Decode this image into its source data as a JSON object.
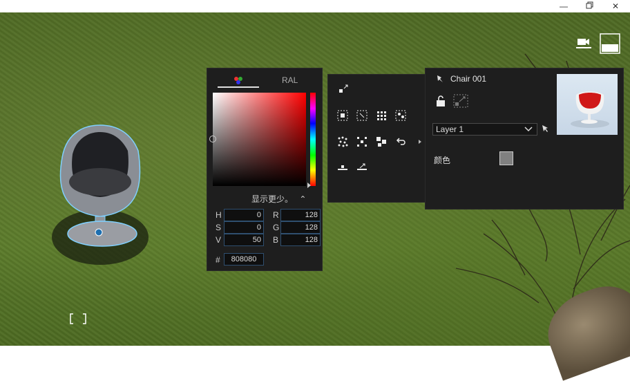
{
  "window": {
    "min_icon": "minimize-icon",
    "restore_icon": "restore-icon",
    "close_icon": "close-icon"
  },
  "viewport": {
    "camera_icon": "camera-icon",
    "layout_icon": "layout-toggle-icon",
    "frame_icon": "frame-selection-icon"
  },
  "color_picker": {
    "tabs": {
      "wheel_icon": "color-wheel-icon",
      "ral_label": "RAL"
    },
    "show_less_label": "显示更少。",
    "show_less_icon": "chevron-up-icon",
    "hsv": {
      "h_label": "H",
      "h_value": "0",
      "s_label": "S",
      "s_value": "0",
      "v_label": "V",
      "v_value": "50"
    },
    "rgb": {
      "r_label": "R",
      "r_value": "128",
      "g_label": "G",
      "g_value": "128",
      "b_label": "B",
      "b_value": "128"
    },
    "hex_label": "#",
    "hex_value": "808080",
    "base_hue_color": "#ff0000"
  },
  "tools": {
    "icons": [
      "move-to-icon",
      "select-group-icon",
      "select-region-icon",
      "select-grid-icon",
      "select-points-icon",
      "scatter-icon",
      "distribute-icon",
      "group-icon",
      "undo-icon",
      "expand-arrow-icon",
      "align-floor-icon",
      "snap-icon"
    ]
  },
  "object_panel": {
    "title": "Chair 001",
    "pin_icon": "pin-icon",
    "lock_icon": "unlock-icon",
    "transform_icon": "transform-icon",
    "layer_value": "Layer 1",
    "layer_icon": "dropdown-chevron-icon",
    "pick_icon": "pick-arrow-icon",
    "color_label": "颜色",
    "swatch_color": "#808080"
  }
}
